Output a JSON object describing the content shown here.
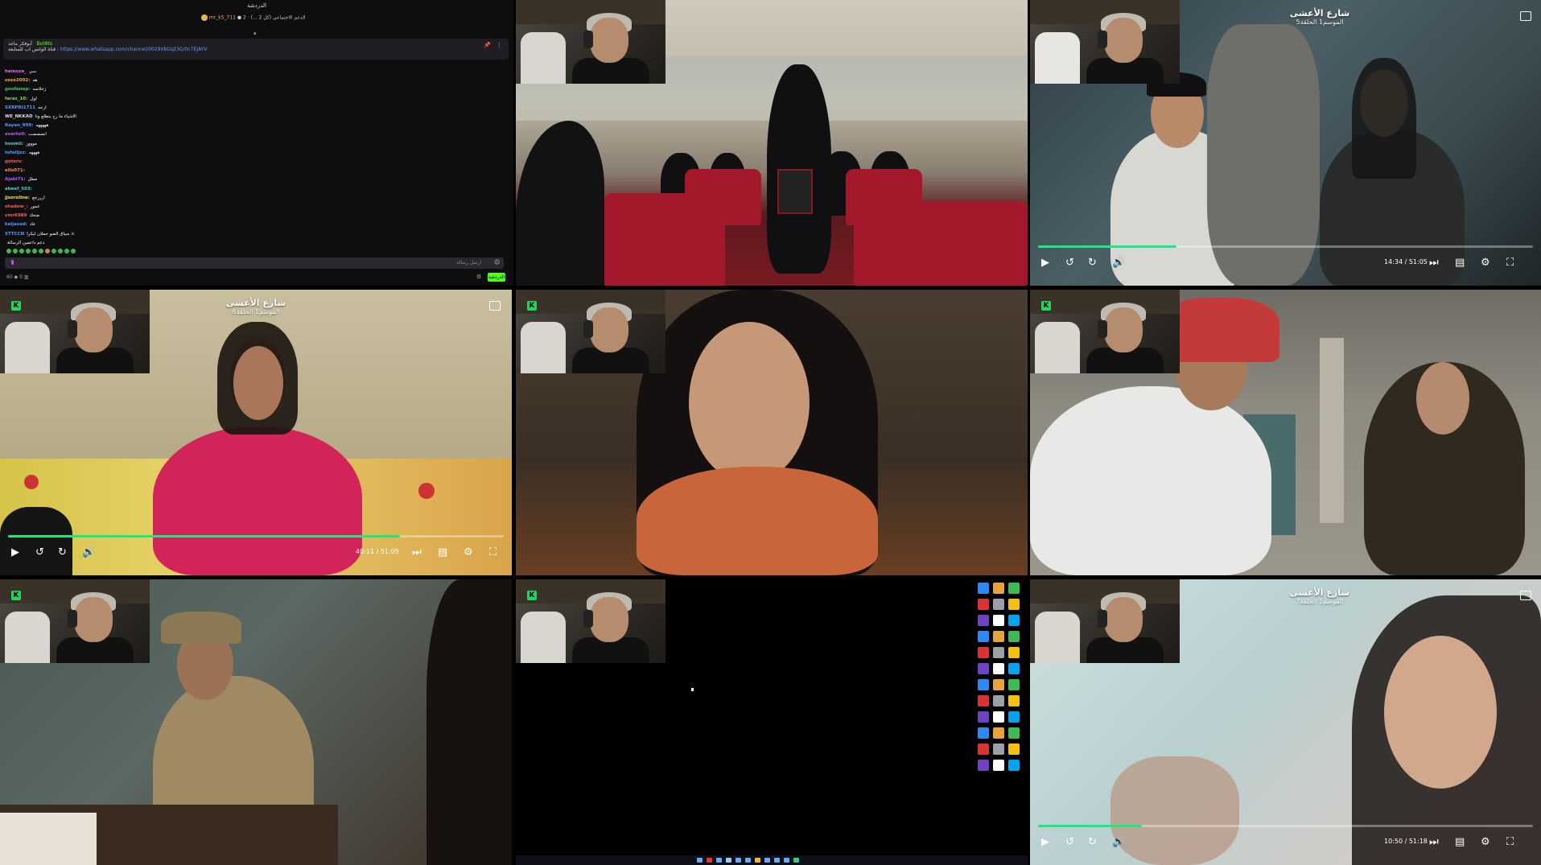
{
  "chat": {
    "top_title": "الدردشة",
    "header_user": "mr_k5_711",
    "header_note": "● 2 · الدعم الاجتماعي (كل 2 ...)",
    "pinned_user": "أبوفكر ماجد",
    "pinned_badge": "Bot8ts",
    "pinned_text": "قناة الواتس اب للمتابعة :",
    "pinned_link": "https://www.whatsapp.com/channel/0029VbGsjt3G/0c7EJAYV",
    "messages": [
      {
        "user": "hamoza_",
        "text": "سي",
        "color": "#e36bff"
      },
      {
        "user": "zezo2002:",
        "text": "هه",
        "color": "#e8a73d"
      },
      {
        "user": "goofanop:",
        "text": "زخلاصه",
        "color": "#42c96b"
      },
      {
        "user": "faraz_10:",
        "text": "لول",
        "color": "#8fd14f"
      },
      {
        "user": "SXRPRI1711",
        "text": "ارحه",
        "color": "#4c9bff"
      },
      {
        "user": "WE_NKKAD",
        "text": "الاشياء ما رح ينطلع ونا",
        "color": "#ddd"
      },
      {
        "user": "Rayan_999:",
        "text": "هههههه",
        "color": "#4f9cff"
      },
      {
        "user": "overtoll:",
        "text": "انصصصب",
        "color": "#bd61ff"
      },
      {
        "user": "hoomii:",
        "text": "مووور",
        "color": "#5ad1c1"
      },
      {
        "user": "tofailjsz:",
        "text": "ههههه",
        "color": "#4c9bff"
      },
      {
        "user": "goters:",
        "text": "",
        "color": "#ff5a5a"
      },
      {
        "user": "ello071:",
        "text": "",
        "color": "#ff8f3d"
      },
      {
        "user": "Ajabi71:",
        "text": "مطل",
        "color": "#b45bff"
      },
      {
        "user": "abeef_503:",
        "text": "",
        "color": "#4ccfd1"
      },
      {
        "user": "jjsoroline:",
        "text": "ارررجع",
        "color": "#e8e84c"
      },
      {
        "user": "shadow_:",
        "text": "عمور",
        "color": "#ff5a5a"
      },
      {
        "user": "vmr6989",
        "text": "ضحك",
        "color": "#ff5a5a"
      },
      {
        "user": "kaljasad:",
        "text": "عاد",
        "color": "#4c9bff"
      },
      {
        "user": "STTCCN",
        "text": "سياق الضو حملان ليكرا ⚔",
        "color": "#4c9bff"
      },
      {
        "user": "",
        "text": "دعم داعمين الرسالة",
        "color": "#888"
      }
    ],
    "input_placeholder": "ارسل رسالة",
    "footer_left": "60 ◆  0 ▥",
    "send_button": "الدردشة"
  },
  "players": [
    {
      "id": "p3",
      "title": "شارع الأعشى",
      "episode": "الموسم1 الحلقة5",
      "time": "14:34",
      "duration": "51:05",
      "progress": 0.28
    },
    {
      "id": "p4",
      "title": "شارع الأعشى",
      "episode": "الموسم1 الحلقة6",
      "time": "40:11",
      "duration": "51:05",
      "progress": 0.79
    },
    {
      "id": "p9",
      "title": "شارع الأعشى",
      "episode": "الموسم1 الحلقة7",
      "time": "10:50",
      "duration": "51:18",
      "progress": 0.21
    }
  ],
  "icons": {
    "play": "play-icon",
    "rewind": "rewind-10-icon",
    "forward": "forward-10-icon",
    "volume": "volume-icon",
    "next": "next-episode-icon",
    "subtitles": "subtitles-icon",
    "settings": "gear-icon",
    "fullscreen": "fullscreen-icon",
    "cast": "cast-icon"
  },
  "colors": {
    "accent": "#1ce783",
    "chat_bg": "#0e0e10",
    "kick_green": "#53fc18",
    "seat_red": "#a3182a"
  }
}
